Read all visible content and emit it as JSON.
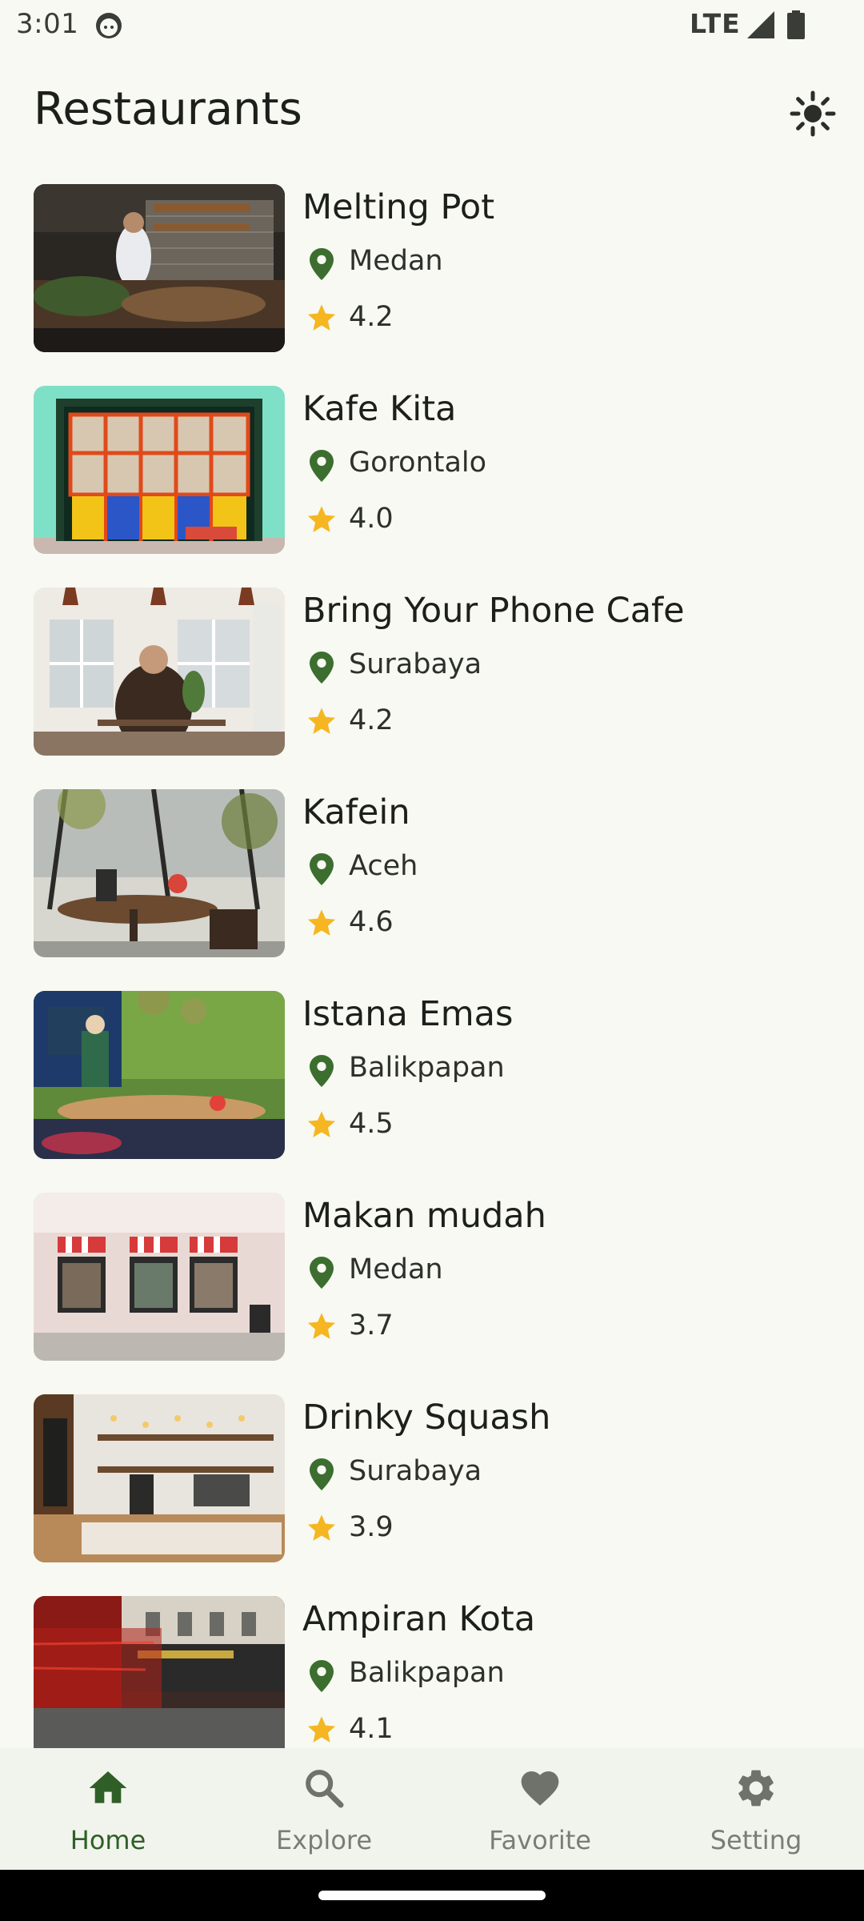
{
  "status_bar": {
    "time": "3:01",
    "network": "LTE",
    "icons": [
      "assistant-face-icon",
      "signal-icon",
      "battery-icon"
    ]
  },
  "app_bar": {
    "title": "Restaurants",
    "theme_toggle_icon": "sun-icon"
  },
  "colors": {
    "background": "#f7f9f2",
    "primary": "#2f5f27",
    "location_pin": "#3c6e2f",
    "star": "#f5b621",
    "nav_inactive": "#7a7d76"
  },
  "restaurants": [
    {
      "name": "Melting Pot",
      "city": "Medan",
      "rating": "4.2"
    },
    {
      "name": "Kafe Kita",
      "city": "Gorontalo",
      "rating": "4.0"
    },
    {
      "name": "Bring Your Phone Cafe",
      "city": "Surabaya",
      "rating": "4.2"
    },
    {
      "name": "Kafein",
      "city": "Aceh",
      "rating": "4.6"
    },
    {
      "name": "Istana Emas",
      "city": "Balikpapan",
      "rating": "4.5"
    },
    {
      "name": "Makan mudah",
      "city": "Medan",
      "rating": "3.7"
    },
    {
      "name": "Drinky Squash",
      "city": "Surabaya",
      "rating": "3.9"
    },
    {
      "name": "Ampiran Kota",
      "city": "Balikpapan",
      "rating": "4.1"
    }
  ],
  "bottom_nav": {
    "items": [
      {
        "label": "Home",
        "icon": "home-icon",
        "active": true
      },
      {
        "label": "Explore",
        "icon": "search-icon",
        "active": false
      },
      {
        "label": "Favorite",
        "icon": "heart-icon",
        "active": false
      },
      {
        "label": "Setting",
        "icon": "gear-icon",
        "active": false
      }
    ]
  }
}
